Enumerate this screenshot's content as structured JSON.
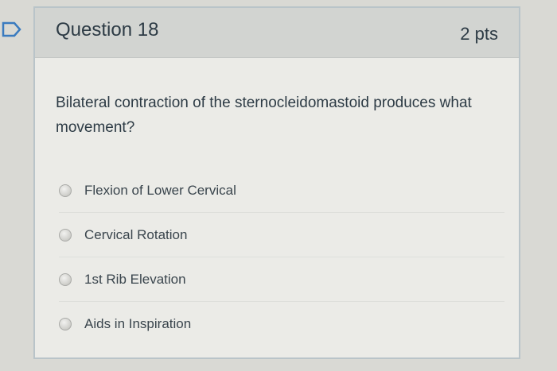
{
  "question": {
    "title": "Question 18",
    "points": "2 pts",
    "text": "Bilateral contraction of the sternocleidomastoid produces what movement?"
  },
  "answers": [
    {
      "label": "Flexion of Lower Cervical"
    },
    {
      "label": "Cervical Rotation"
    },
    {
      "label": "1st Rib Elevation"
    },
    {
      "label": "Aids in Inspiration"
    }
  ],
  "colors": {
    "text": "#2d3b45",
    "header_bg": "#d2d4d1",
    "card_border": "#b9c4c9",
    "bookmark": "#3a7bbf"
  },
  "icons": {
    "bookmark": "bookmark-flag-icon"
  }
}
